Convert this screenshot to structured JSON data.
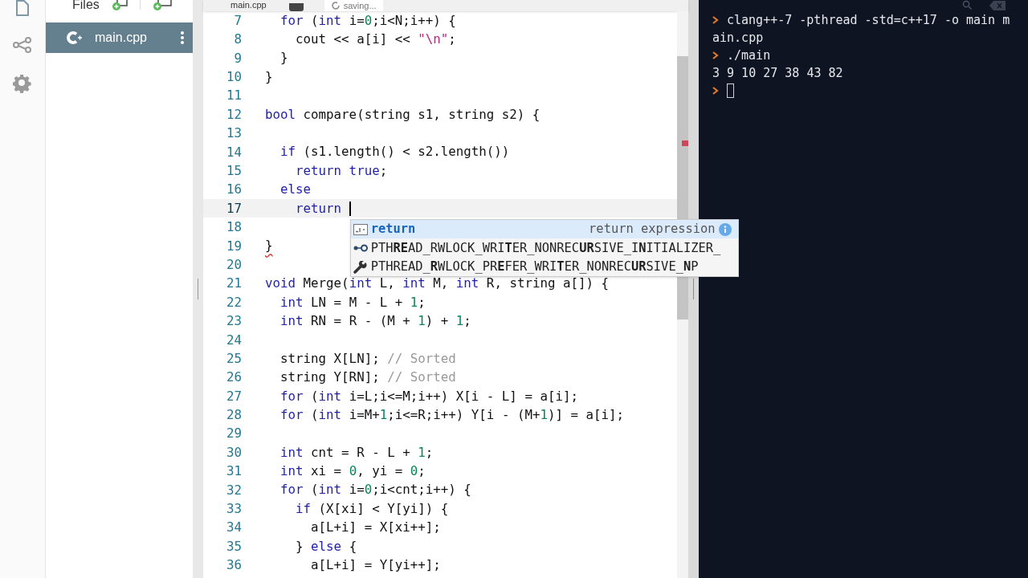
{
  "file_panel": {
    "title": "Files",
    "files": [
      {
        "name": "main.cpp",
        "selected": true
      }
    ]
  },
  "editor": {
    "tabs": [
      {
        "label": "main.cpp",
        "selected": true
      }
    ],
    "save_status": "saving...",
    "lines": [
      {
        "number": "7",
        "current": false,
        "tokens": [
          {
            "kind": "keyword",
            "text": "  for"
          },
          {
            "kind": "plain",
            "text": " ("
          },
          {
            "kind": "keyword",
            "text": "int"
          },
          {
            "kind": "plain",
            "text": " i="
          },
          {
            "kind": "number",
            "text": "0"
          },
          {
            "kind": "plain",
            "text": ";i<N;i++) {"
          }
        ]
      },
      {
        "number": "8",
        "current": false,
        "tokens": [
          {
            "kind": "plain",
            "text": "    cout << a[i] << "
          },
          {
            "kind": "string",
            "text": "\"\\n\""
          },
          {
            "kind": "plain",
            "text": ";"
          }
        ]
      },
      {
        "number": "9",
        "current": false,
        "tokens": [
          {
            "kind": "plain",
            "text": "  }"
          }
        ]
      },
      {
        "number": "10",
        "current": false,
        "tokens": [
          {
            "kind": "plain",
            "text": "}"
          }
        ]
      },
      {
        "number": "11",
        "current": false
      },
      {
        "number": "12",
        "current": false,
        "tokens": [
          {
            "kind": "keyword",
            "text": "bool"
          },
          {
            "kind": "plain",
            "text": " compare(string s1, string s2) {"
          }
        ]
      },
      {
        "number": "13",
        "current": false
      },
      {
        "number": "14",
        "current": false,
        "tokens": [
          {
            "kind": "keyword",
            "text": "  if"
          },
          {
            "kind": "plain",
            "text": " (s1.length() < s2.length())"
          }
        ]
      },
      {
        "number": "15",
        "current": false,
        "tokens": [
          {
            "kind": "keyword",
            "text": "    return true"
          },
          {
            "kind": "plain",
            "text": ";"
          }
        ]
      },
      {
        "number": "16",
        "current": false,
        "tokens": [
          {
            "kind": "keyword",
            "text": "  else"
          }
        ]
      },
      {
        "number": "17",
        "current": true,
        "tokens": [
          {
            "kind": "keyword",
            "text": "    return "
          }
        ]
      },
      {
        "number": "18",
        "current": false
      },
      {
        "number": "19",
        "current": false,
        "tokens": [
          {
            "kind": "error",
            "text": "}"
          }
        ]
      },
      {
        "number": "20",
        "current": false
      },
      {
        "number": "21",
        "current": false,
        "tokens": [
          {
            "kind": "keyword",
            "text": "void"
          },
          {
            "kind": "plain",
            "text": " Merge("
          },
          {
            "kind": "keyword",
            "text": "int"
          },
          {
            "kind": "plain",
            "text": " L, "
          },
          {
            "kind": "keyword",
            "text": "int"
          },
          {
            "kind": "plain",
            "text": " M, "
          },
          {
            "kind": "keyword",
            "text": "int"
          },
          {
            "kind": "plain",
            "text": " R, string a[]) {"
          }
        ]
      },
      {
        "number": "22",
        "current": false,
        "tokens": [
          {
            "kind": "keyword",
            "text": "  int"
          },
          {
            "kind": "plain",
            "text": " LN = M - L + "
          },
          {
            "kind": "number",
            "text": "1"
          },
          {
            "kind": "plain",
            "text": ";"
          }
        ]
      },
      {
        "number": "23",
        "current": false,
        "tokens": [
          {
            "kind": "keyword",
            "text": "  int"
          },
          {
            "kind": "plain",
            "text": " RN = R - (M + "
          },
          {
            "kind": "number",
            "text": "1"
          },
          {
            "kind": "plain",
            "text": ") + "
          },
          {
            "kind": "number",
            "text": "1"
          },
          {
            "kind": "plain",
            "text": ";"
          }
        ]
      },
      {
        "number": "24",
        "current": false
      },
      {
        "number": "25",
        "current": false,
        "tokens": [
          {
            "kind": "plain",
            "text": "  string X[LN]; "
          },
          {
            "kind": "comment",
            "text": "// Sorted"
          }
        ]
      },
      {
        "number": "26",
        "current": false,
        "tokens": [
          {
            "kind": "plain",
            "text": "  string Y[RN]; "
          },
          {
            "kind": "comment",
            "text": "// Sorted"
          }
        ]
      },
      {
        "number": "27",
        "current": false,
        "tokens": [
          {
            "kind": "keyword",
            "text": "  for"
          },
          {
            "kind": "plain",
            "text": " ("
          },
          {
            "kind": "keyword",
            "text": "int"
          },
          {
            "kind": "plain",
            "text": " i=L;i<=M;i++) X[i - L] = a[i];"
          }
        ]
      },
      {
        "number": "28",
        "current": false,
        "tokens": [
          {
            "kind": "keyword",
            "text": "  for"
          },
          {
            "kind": "plain",
            "text": " ("
          },
          {
            "kind": "keyword",
            "text": "int"
          },
          {
            "kind": "plain",
            "text": " i=M+"
          },
          {
            "kind": "number",
            "text": "1"
          },
          {
            "kind": "plain",
            "text": ";i<=R;i++) Y[i - (M+"
          },
          {
            "kind": "number",
            "text": "1"
          },
          {
            "kind": "plain",
            "text": ")] = a[i];"
          }
        ]
      },
      {
        "number": "29",
        "current": false
      },
      {
        "number": "30",
        "current": false,
        "tokens": [
          {
            "kind": "keyword",
            "text": "  int"
          },
          {
            "kind": "plain",
            "text": " cnt = R - L + "
          },
          {
            "kind": "number",
            "text": "1"
          },
          {
            "kind": "plain",
            "text": ";"
          }
        ]
      },
      {
        "number": "31",
        "current": false,
        "tokens": [
          {
            "kind": "keyword",
            "text": "  int"
          },
          {
            "kind": "plain",
            "text": " xi = "
          },
          {
            "kind": "number",
            "text": "0"
          },
          {
            "kind": "plain",
            "text": ", yi = "
          },
          {
            "kind": "number",
            "text": "0"
          },
          {
            "kind": "plain",
            "text": ";"
          }
        ]
      },
      {
        "number": "32",
        "current": false,
        "tokens": [
          {
            "kind": "keyword",
            "text": "  for"
          },
          {
            "kind": "plain",
            "text": " ("
          },
          {
            "kind": "keyword",
            "text": "int"
          },
          {
            "kind": "plain",
            "text": " i="
          },
          {
            "kind": "number",
            "text": "0"
          },
          {
            "kind": "plain",
            "text": ";i<cnt;i++) {"
          }
        ]
      },
      {
        "number": "33",
        "current": false,
        "tokens": [
          {
            "kind": "keyword",
            "text": "    if"
          },
          {
            "kind": "plain",
            "text": " (X[xi] < Y[yi]) {"
          }
        ]
      },
      {
        "number": "34",
        "current": false,
        "tokens": [
          {
            "kind": "plain",
            "text": "      a[L+i] = X[xi++];"
          }
        ]
      },
      {
        "number": "35",
        "current": false,
        "tokens": [
          {
            "kind": "plain",
            "text": "    } "
          },
          {
            "kind": "keyword",
            "text": "else"
          },
          {
            "kind": "plain",
            "text": " {"
          }
        ]
      },
      {
        "number": "36",
        "current": false,
        "tokens": [
          {
            "kind": "plain",
            "text": "      a[L+i] = Y[yi++];"
          }
        ]
      }
    ],
    "autocomplete": [
      {
        "kind": "keyword",
        "label": "return",
        "detail": "return expression",
        "selected": true
      },
      {
        "kind": "constant",
        "label": "PTH**RE**AD_RWLOCK_WRI**T**ER_NONREC**UR**SIVE_I**N**ITIALIZER_",
        "selected": false
      },
      {
        "kind": "macro",
        "label": "PTHREAD_**R**WLOCK_PR**E**FER_WRI**T**ER_NONREC**UR**SIVE_**N**P",
        "selected": false
      }
    ]
  },
  "terminal": {
    "lines": [
      {
        "kind": "command",
        "text": "clang++-7 -pthread -std=c++17 -o main m"
      },
      {
        "kind": "output",
        "text": "ain.cpp"
      },
      {
        "kind": "command",
        "text": "./main"
      },
      {
        "kind": "output",
        "text": "3 9 10 27 38 43 82"
      },
      {
        "kind": "prompt"
      }
    ]
  }
}
